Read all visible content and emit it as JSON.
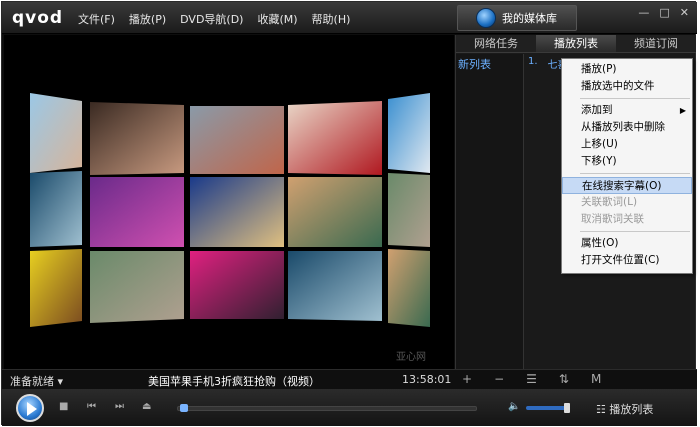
{
  "app": {
    "logo": "qvod",
    "menu": [
      "文件(F)",
      "播放(P)",
      "DVD导航(D)",
      "收藏(M)",
      "帮助(H)"
    ],
    "library_button": "我的媒体库"
  },
  "video": {
    "watermark": "亚心网"
  },
  "panel": {
    "tabs": [
      "网络任务",
      "播放列表",
      "频道订阅"
    ],
    "active_tab": 1,
    "list_name": "新列表",
    "items": [
      {
        "index": "1.",
        "title": "七喜"
      }
    ]
  },
  "context_menu": [
    {
      "label": "播放(P)",
      "disabled": false
    },
    {
      "label": "播放选中的文件",
      "disabled": false
    },
    {
      "sep": true
    },
    {
      "label": "添加到",
      "disabled": false,
      "submenu": true
    },
    {
      "label": "从播放列表中删除",
      "disabled": false
    },
    {
      "label": "上移(U)",
      "disabled": false
    },
    {
      "label": "下移(Y)",
      "disabled": false
    },
    {
      "sep": true
    },
    {
      "label": "在线搜索字幕(O)",
      "disabled": false,
      "highlight": true
    },
    {
      "label": "关联歌词(L)",
      "disabled": true
    },
    {
      "label": "取消歌词关联",
      "disabled": true
    },
    {
      "sep": true
    },
    {
      "label": "属性(O)",
      "disabled": false
    },
    {
      "label": "打开文件位置(C)",
      "disabled": false
    }
  ],
  "status": {
    "state": "准备就绪",
    "now_playing": "美国苹果手机3折疯狂抢购（视频）",
    "time": "13:58:01"
  },
  "controls": {
    "playlist_button": "播放列表"
  }
}
